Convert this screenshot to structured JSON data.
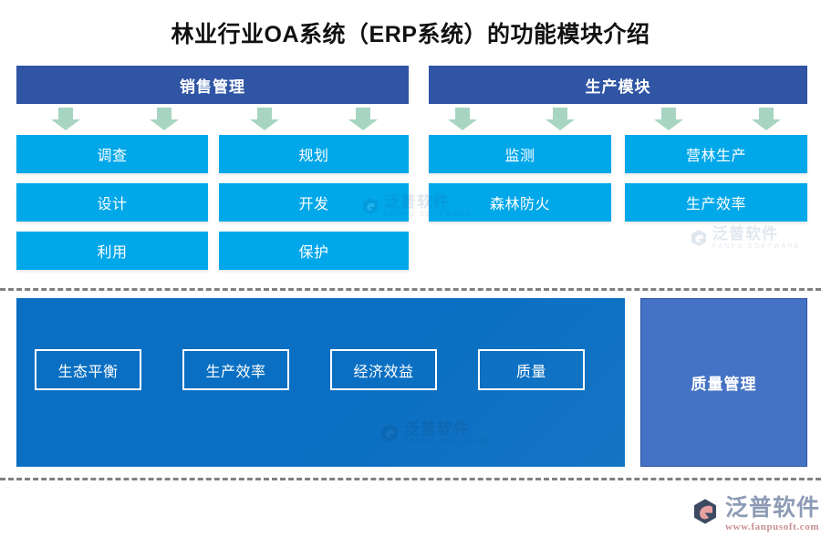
{
  "page": {
    "title": "林业行业OA系统（ERP系统）的功能模块介绍",
    "background_color": "#ffffff"
  },
  "colors": {
    "header_bar": "#2f55a4",
    "card": "#00a7e9",
    "arrow": "#a8d5c2",
    "panel_main": "#0a6fc2",
    "panel_side": "#4472c4",
    "divider": "#808080",
    "title_text": "#111111"
  },
  "sections": [
    {
      "id": "sales",
      "header": "销售管理",
      "cards": [
        {
          "label": "调查",
          "row": 1,
          "col": 1
        },
        {
          "label": "规划",
          "row": 1,
          "col": 2
        },
        {
          "label": "设计",
          "row": 2,
          "col": 1
        },
        {
          "label": "开发",
          "row": 2,
          "col": 2
        },
        {
          "label": "利用",
          "row": 3,
          "col": 1
        },
        {
          "label": "保护",
          "row": 3,
          "col": 2
        }
      ]
    },
    {
      "id": "production",
      "header": "生产模块",
      "cards": [
        {
          "label": "监测",
          "row": 1,
          "col": 1
        },
        {
          "label": "营林生产",
          "row": 1,
          "col": 2
        },
        {
          "label": "森林防火",
          "row": 2,
          "col": 1
        },
        {
          "label": "生产效率",
          "row": 2,
          "col": 2
        }
      ]
    }
  ],
  "arrows": [
    {
      "name": "arrow-down-1"
    },
    {
      "name": "arrow-down-2"
    },
    {
      "name": "arrow-down-3"
    },
    {
      "name": "arrow-down-4"
    },
    {
      "name": "arrow-down-5"
    },
    {
      "name": "arrow-down-6"
    },
    {
      "name": "arrow-down-7"
    },
    {
      "name": "arrow-down-8"
    }
  ],
  "lower": {
    "chips": [
      {
        "label": "生态平衡"
      },
      {
        "label": "生产效率"
      },
      {
        "label": "经济效益"
      },
      {
        "label": "质量"
      }
    ],
    "side_panel_label": "质量管理"
  },
  "watermark": {
    "cn": "泛普软件",
    "en": "FANPU SOFTWARE"
  },
  "brand": {
    "cn": "泛普软件",
    "url": "www.fanpusoft.com"
  }
}
